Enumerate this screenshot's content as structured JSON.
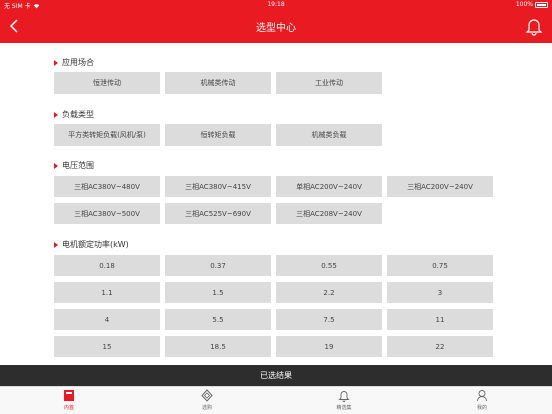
{
  "status": {
    "carrier": "无 SIM 卡",
    "time": "19:18",
    "battery": "100%"
  },
  "nav": {
    "title": "选型中心"
  },
  "sections": [
    {
      "title": "应用场合",
      "options": [
        "恒泄传动",
        "机械类传动",
        "工业传动"
      ]
    },
    {
      "title": "负载类型",
      "options": [
        "平方类转矩负载(风机/泵)",
        "恒转矩负载",
        "机械类负载"
      ]
    },
    {
      "title": "电压范围",
      "options": [
        "三相AC380V~480V",
        "三相AC380V~415V",
        "单相AC200V~240V",
        "三相AC200V~240V",
        "三相AC380V~500V",
        "三相AC525V~690V",
        "三相AC208V~240V"
      ]
    },
    {
      "title": "电机额定功率(kW)",
      "options": [
        "0.18",
        "0.37",
        "0.55",
        "0.75",
        "1.1",
        "1.5",
        "2.2",
        "3",
        "4",
        "5.5",
        "7.5",
        "11",
        "15",
        "18.5",
        "19",
        "22"
      ]
    }
  ],
  "result_label": "已选结果",
  "tabs": [
    {
      "label": "内首",
      "icon": "home-icon",
      "active": true
    },
    {
      "label": "选购",
      "icon": "diamond-icon",
      "active": false
    },
    {
      "label": "精选集",
      "icon": "bell-icon",
      "active": false
    },
    {
      "label": "我的",
      "icon": "person-icon",
      "active": false
    }
  ],
  "colors": {
    "accent": "#ea1a22",
    "option_bg": "#dcdcdc",
    "result_bar": "#2d2d2d"
  }
}
